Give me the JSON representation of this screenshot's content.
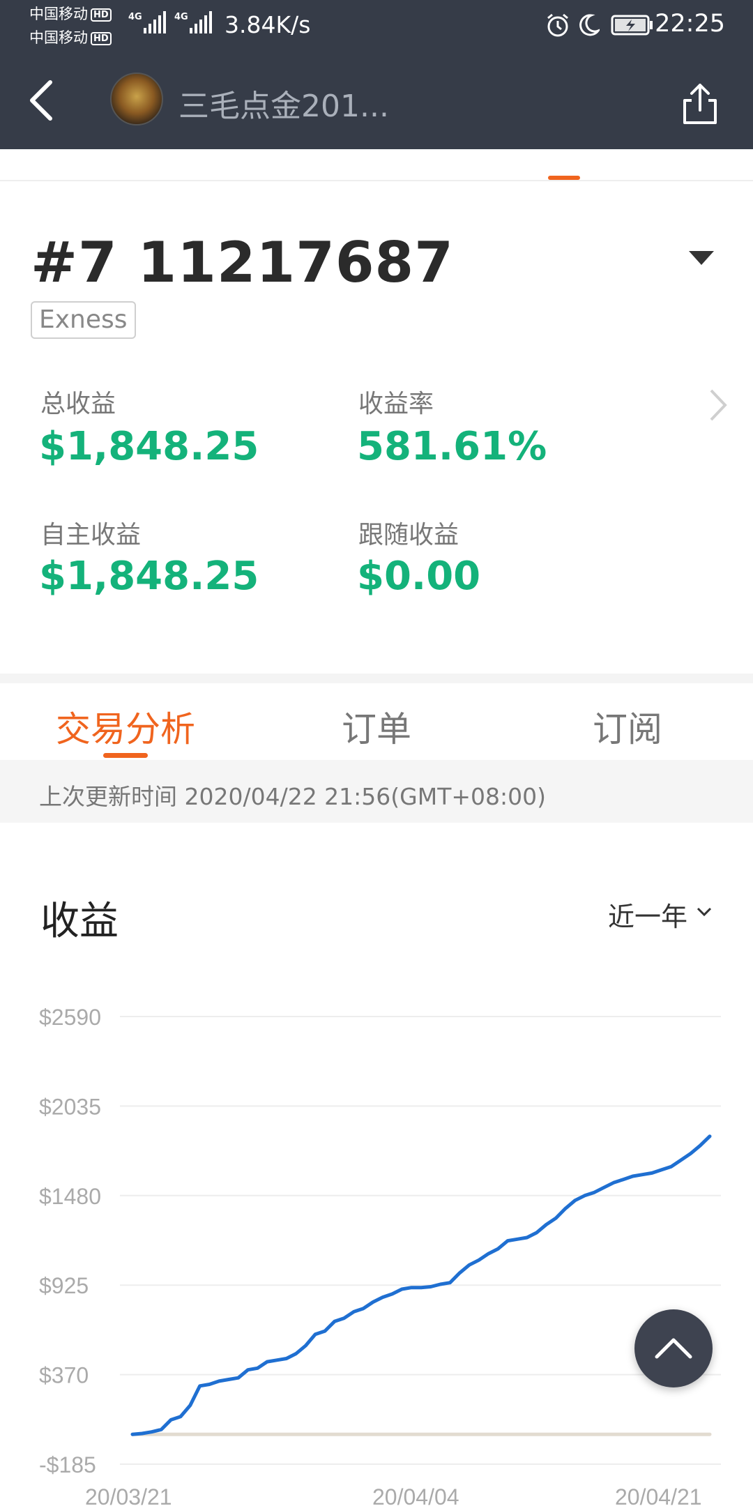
{
  "status_bar": {
    "carrier1": "中国移动",
    "carrier2": "中国移动",
    "hd_badge": "HD",
    "net1": "4G",
    "net2": "4G",
    "speed": "3.84K/s",
    "time": "22:25",
    "icons": [
      "alarm-icon",
      "moon-icon",
      "battery-charging-icon"
    ]
  },
  "header": {
    "title": "三毛点金201...",
    "back_icon": "back-chevron-icon",
    "share_icon": "share-icon",
    "avatar": "avatar"
  },
  "account": {
    "number": "#7 11217687",
    "broker": "Exness",
    "stats": [
      {
        "label": "总收益",
        "value": "$1,848.25"
      },
      {
        "label": "收益率",
        "value": "581.61%"
      },
      {
        "label": "自主收益",
        "value": "$1,848.25"
      },
      {
        "label": "跟随收益",
        "value": "$0.00"
      }
    ]
  },
  "tabs": [
    "交易分析",
    "订单",
    "订阅"
  ],
  "active_tab": 0,
  "update": "上次更新时间 2020/04/22 21:56(GMT+08:00)",
  "section": {
    "title": "收益",
    "range": "近一年"
  },
  "colors": {
    "accent": "#f0641e",
    "profit_green": "#14b27a",
    "line_blue": "#1f6fd1",
    "header_bg": "#363c48"
  },
  "chart_data": {
    "type": "line",
    "y_ticks": [
      "$2590",
      "$2035",
      "$1480",
      "$925",
      "$370",
      "-$185"
    ],
    "ylim": [
      -185,
      2590
    ],
    "x_ticks": [
      "20/03/21",
      "20/04/04",
      "20/04/21"
    ],
    "series": [
      {
        "values": [
          0,
          5,
          15,
          30,
          90,
          110,
          180,
          300,
          310,
          330,
          340,
          350,
          400,
          410,
          450,
          460,
          470,
          500,
          550,
          620,
          640,
          700,
          720,
          760,
          780,
          820,
          850,
          870,
          900,
          910,
          910,
          915,
          930,
          940,
          1000,
          1050,
          1080,
          1120,
          1150,
          1200,
          1210,
          1220,
          1250,
          1300,
          1340,
          1400,
          1450,
          1480,
          1500,
          1530,
          1560,
          1580,
          1600,
          1610,
          1620,
          1640,
          1660,
          1700,
          1740,
          1790,
          1848
        ]
      },
      {
        "values": [
          0,
          0,
          0,
          0,
          0,
          0,
          0,
          0,
          0,
          0,
          0,
          0,
          0,
          0,
          0,
          0,
          0,
          0,
          0,
          0,
          0,
          0,
          0,
          0,
          0,
          0,
          0,
          0,
          0,
          0,
          0,
          0,
          0,
          0,
          0,
          0,
          0,
          0,
          0,
          0,
          0,
          0,
          0,
          0,
          0,
          0,
          0,
          0,
          0,
          0,
          0,
          0,
          0,
          0,
          0,
          0,
          0,
          0,
          0,
          0,
          0
        ]
      }
    ],
    "grid": true
  }
}
